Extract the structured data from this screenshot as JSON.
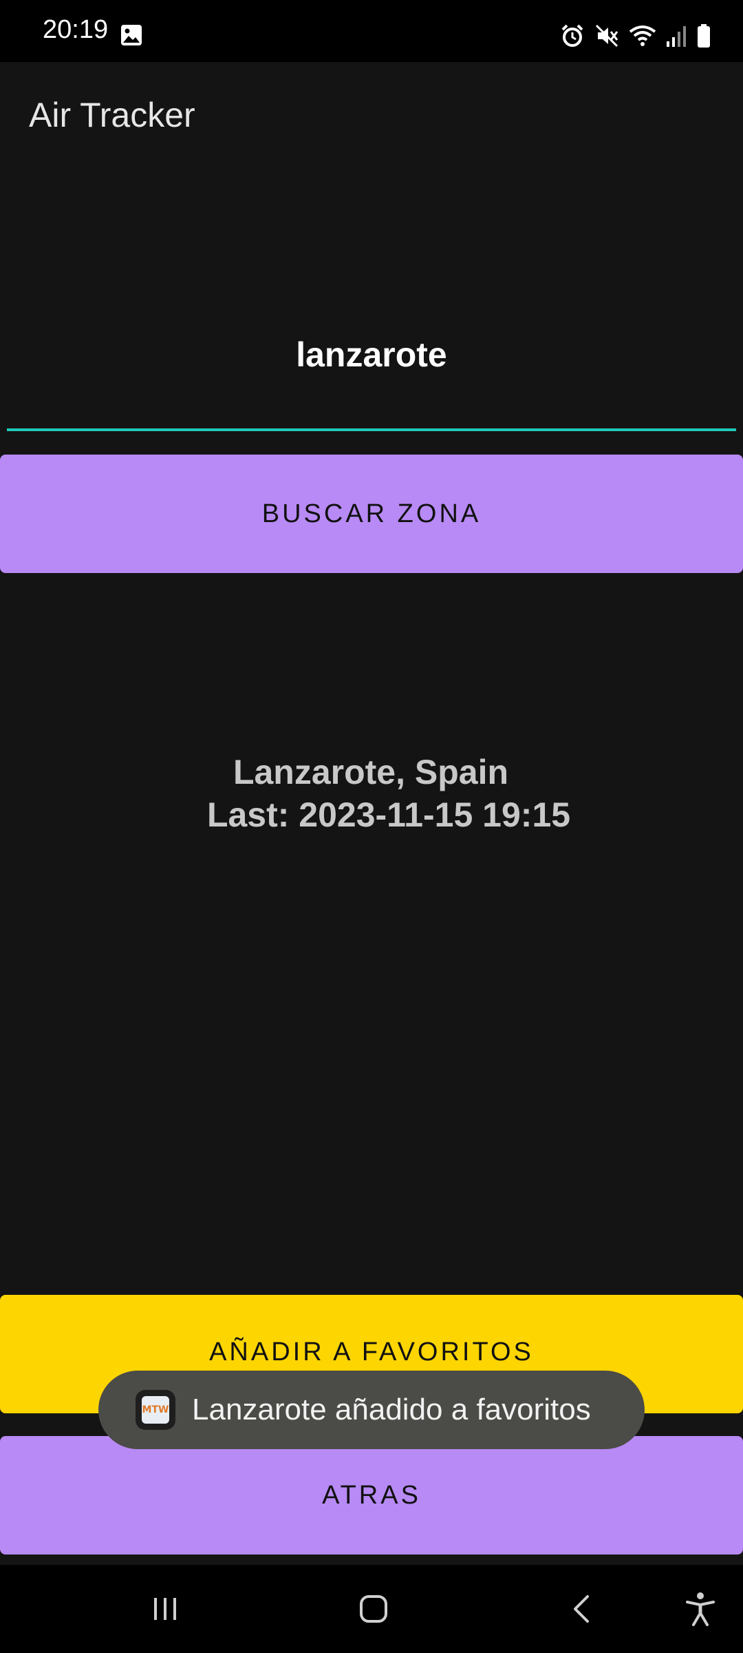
{
  "status_bar": {
    "time": "20:19",
    "icons": [
      "gallery-icon",
      "alarm-icon",
      "mute-icon",
      "wifi-icon",
      "signal-icon",
      "battery-icon"
    ]
  },
  "app_bar": {
    "title": "Air Tracker"
  },
  "search": {
    "value": "lanzarote",
    "underline_color": "#1ec9b8"
  },
  "buttons": {
    "search_label": "BUSCAR ZONA",
    "favorite_label": "AÑADIR A FAVORITOS",
    "back_label": "ATRAS",
    "primary_color": "#b88af5",
    "favorite_color": "#fdd501"
  },
  "result": {
    "location": "Lanzarote, Spain",
    "last_update": "Last: 2023-11-15 19:15"
  },
  "toast": {
    "message": "Lanzarote añadido a favoritos",
    "app_icon_text": "MTW"
  },
  "navigation": {
    "items": [
      "recents-icon",
      "home-icon",
      "back-icon",
      "accessibility-icon"
    ]
  }
}
